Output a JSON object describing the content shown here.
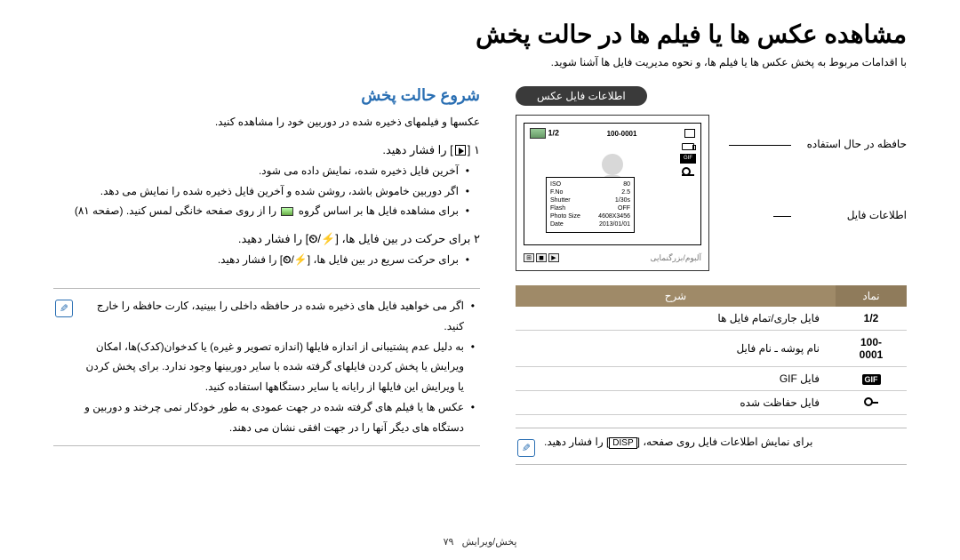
{
  "title": "مشاهده عکس ها یا فیلم ها در حالت پخش",
  "intro": "با اقدامات مربوط به پخش عکس ها یا فیلم ها، و نحوه مدیریت فایل ها آشنا شوید.",
  "right": {
    "h2": "شروع حالت پخش",
    "p": "عکسها و فیلمهای ذخیره شده در دوربین خود را مشاهده کنید.",
    "step1": {
      "num": "۱",
      "after_icon": "را فشار دهید."
    },
    "step1_bullets": [
      "آخرین فایل ذخیره شده، نمایش داده می شود.",
      "اگر دوربین خاموش باشد، روشن شده و آخرین فایل ذخیره شده را نمایش می دهد.",
      "برای مشاهده فایل ها بر اساس گروه     را از روی صفحه خانگی لمس کنید. (صفحه ۸۱)"
    ],
    "step2": {
      "num": "۲",
      "text": "برای حرکت در بین فایل ها، [ / ] را فشار دهید."
    },
    "step2_bullets": [
      "برای حرکت سریع در بین فایل ها، [ / ] را فشار دهید."
    ],
    "note": [
      "اگر می خواهید فایل های ذخیره شده در حافظه داخلی را ببینید، کارت حافظه را خارج کنید.",
      "به دلیل عدم پشتیبانی از اندازه فایلها (اندازه تصویر و غیره) یا کدخوان(کدک)ها، امکان ویرایش یا پخش کردن فایلهای گرفته شده با سایر دوربینها وجود ندارد. برای پخش کردن یا ویرایش این فایلها از رایانه یا سایر دستگاهها استفاده کنید.",
      "عکس ها یا فیلم های گرفته شده در جهت عمودی به طور خودکار نمی چرخند و دوربین و دستگاه های دیگر آنها را در جهت افقی نشان می دهند."
    ]
  },
  "left": {
    "pill": "اطلاعات فایل عکس",
    "label_a": "حافظه در حال استفاده",
    "label_b": "اطلاعات فایل",
    "screen": {
      "counter": "1/2",
      "folder": "100-0001",
      "exif": [
        {
          "k": "ISO",
          "v": "80"
        },
        {
          "k": "F.No",
          "v": "2.5"
        },
        {
          "k": "Shutter",
          "v": "1/30s"
        },
        {
          "k": "Flash",
          "v": "OFF"
        },
        {
          "k": "Photo Size",
          "v": "4608X3456"
        },
        {
          "k": "Date",
          "v": "2013/01/01"
        }
      ],
      "mem_text": "آلبوم/بزرگنمايی",
      "gif": "GIF"
    },
    "thead": {
      "c1": "نماد",
      "c2": "شرح"
    },
    "rows": [
      {
        "sym": "1/2",
        "desc": "فایل جاری/تمام فایل ها"
      },
      {
        "sym": "100-0001",
        "desc": "نام پوشه ـ نام فایل"
      },
      {
        "sym": "GIF",
        "desc": "فایل GIF",
        "sym_type": "giftag"
      },
      {
        "sym": "KEY",
        "desc": "فایل حفاظت شده",
        "sym_type": "key"
      }
    ],
    "note": "برای نمایش اطلاعات فایل روی صفحه،",
    "note_disp": "DISP",
    "note_tail": "را فشار دهید."
  },
  "footer": {
    "p": "۷۹",
    "sec": "پخش/ویرایش"
  }
}
